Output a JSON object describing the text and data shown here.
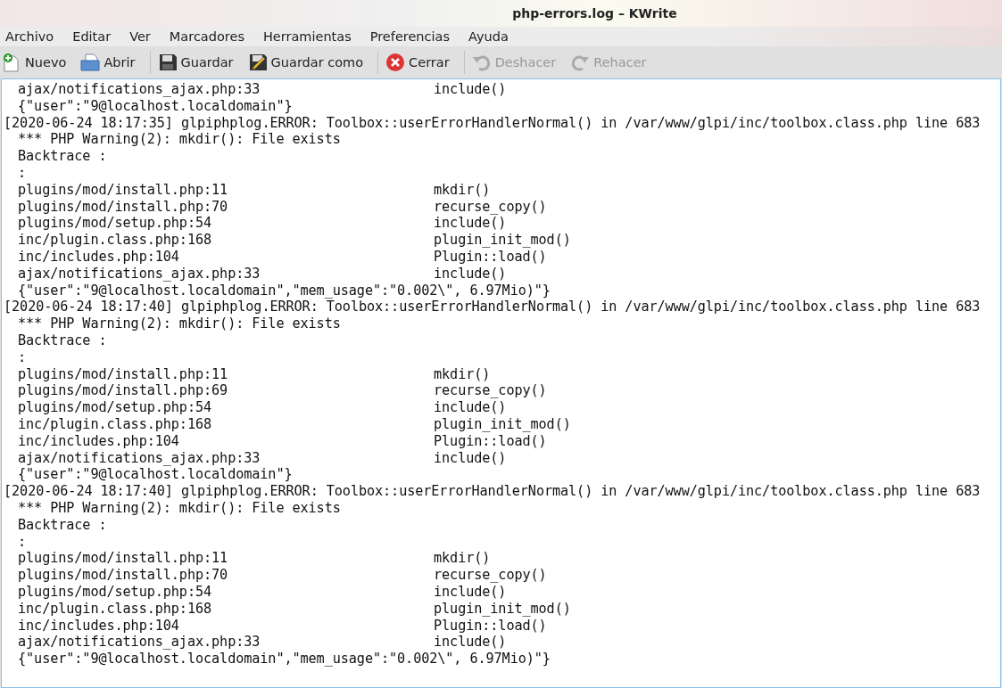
{
  "window": {
    "title": "php-errors.log – KWrite"
  },
  "menu": [
    "Archivo",
    "Editar",
    "Ver",
    "Marcadores",
    "Herramientas",
    "Preferencias",
    "Ayuda"
  ],
  "toolbar": [
    {
      "kind": "new",
      "label": "Nuevo",
      "disabled": false
    },
    {
      "kind": "open",
      "label": "Abrir",
      "disabled": false
    },
    {
      "kind": "save",
      "label": "Guardar",
      "disabled": false
    },
    {
      "kind": "saveas",
      "label": "Guardar como",
      "disabled": false
    },
    {
      "kind": "close",
      "label": "Cerrar",
      "disabled": false
    },
    {
      "kind": "undo",
      "label": "Deshacer",
      "disabled": true
    },
    {
      "kind": "redo",
      "label": "Rehacer",
      "disabled": true
    }
  ],
  "lines": [
    {
      "kind": "frame",
      "location": "ajax/notifications_ajax.php:33",
      "call": "include()"
    },
    {
      "kind": "text",
      "text": "{\"user\":\"9@localhost.localdomain\"}"
    },
    {
      "kind": "header",
      "text": "[2020-06-24 18:17:35] glpiphplog.ERROR: Toolbox::userErrorHandlerNormal() in /var/www/glpi/inc/toolbox.class.php line 683"
    },
    {
      "kind": "text",
      "text": "*** PHP Warning(2): mkdir(): File exists"
    },
    {
      "kind": "text",
      "text": "Backtrace :"
    },
    {
      "kind": "text",
      "text": ":"
    },
    {
      "kind": "frame",
      "location": "plugins/mod/install.php:11",
      "call": "mkdir()"
    },
    {
      "kind": "frame",
      "location": "plugins/mod/install.php:70",
      "call": "recurse_copy()"
    },
    {
      "kind": "frame",
      "location": "plugins/mod/setup.php:54",
      "call": "include()"
    },
    {
      "kind": "frame",
      "location": "inc/plugin.class.php:168",
      "call": "plugin_init_mod()"
    },
    {
      "kind": "frame",
      "location": "inc/includes.php:104",
      "call": "Plugin::load()"
    },
    {
      "kind": "frame",
      "location": "ajax/notifications_ajax.php:33",
      "call": "include()"
    },
    {
      "kind": "text",
      "text": "{\"user\":\"9@localhost.localdomain\",\"mem_usage\":\"0.002\\\", 6.97Mio)\"}"
    },
    {
      "kind": "header",
      "text": "[2020-06-24 18:17:40] glpiphplog.ERROR: Toolbox::userErrorHandlerNormal() in /var/www/glpi/inc/toolbox.class.php line 683"
    },
    {
      "kind": "text",
      "text": "*** PHP Warning(2): mkdir(): File exists"
    },
    {
      "kind": "text",
      "text": "Backtrace :"
    },
    {
      "kind": "text",
      "text": ":"
    },
    {
      "kind": "frame",
      "location": "plugins/mod/install.php:11",
      "call": "mkdir()"
    },
    {
      "kind": "frame",
      "location": "plugins/mod/install.php:69",
      "call": "recurse_copy()"
    },
    {
      "kind": "frame",
      "location": "plugins/mod/setup.php:54",
      "call": "include()"
    },
    {
      "kind": "frame",
      "location": "inc/plugin.class.php:168",
      "call": "plugin_init_mod()"
    },
    {
      "kind": "frame",
      "location": "inc/includes.php:104",
      "call": "Plugin::load()"
    },
    {
      "kind": "frame",
      "location": "ajax/notifications_ajax.php:33",
      "call": "include()"
    },
    {
      "kind": "text",
      "text": "{\"user\":\"9@localhost.localdomain\"}"
    },
    {
      "kind": "header",
      "text": "[2020-06-24 18:17:40] glpiphplog.ERROR: Toolbox::userErrorHandlerNormal() in /var/www/glpi/inc/toolbox.class.php line 683"
    },
    {
      "kind": "text",
      "text": "*** PHP Warning(2): mkdir(): File exists"
    },
    {
      "kind": "text",
      "text": "Backtrace :"
    },
    {
      "kind": "text",
      "text": ":"
    },
    {
      "kind": "frame",
      "location": "plugins/mod/install.php:11",
      "call": "mkdir()"
    },
    {
      "kind": "frame",
      "location": "plugins/mod/install.php:70",
      "call": "recurse_copy()"
    },
    {
      "kind": "frame",
      "location": "plugins/mod/setup.php:54",
      "call": "include()"
    },
    {
      "kind": "frame",
      "location": "inc/plugin.class.php:168",
      "call": "plugin_init_mod()"
    },
    {
      "kind": "frame",
      "location": "inc/includes.php:104",
      "call": "Plugin::load()"
    },
    {
      "kind": "frame",
      "location": "ajax/notifications_ajax.php:33",
      "call": "include()"
    },
    {
      "kind": "text",
      "text": "{\"user\":\"9@localhost.localdomain\",\"mem_usage\":\"0.002\\\", 6.97Mio)\"}"
    }
  ]
}
